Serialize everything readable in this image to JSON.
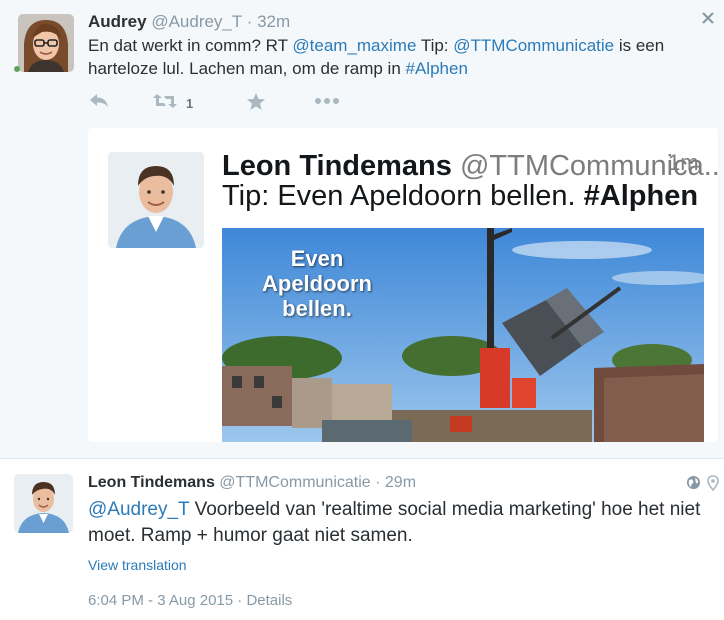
{
  "tweet1": {
    "name": "Audrey",
    "handle": "@Audrey_T",
    "sep": " · ",
    "time": "32m",
    "text_pre": "En dat werkt in comm? RT ",
    "mention1": "@team_maxime",
    "text_mid": " Tip: ",
    "mention2": "@TTMCommunicatie",
    "text_mid2": " is een harteloze lul. Lachen man, om de ramp in ",
    "hashtag": "#Alphen",
    "retweet_count": "1",
    "icons": [
      "reply-icon",
      "retweet-icon",
      "favorite-icon",
      "more-icon",
      "close-icon"
    ]
  },
  "card": {
    "name": "Leon Tindemans",
    "handle": "@TTMCommunica...",
    "time": "1m",
    "text": "Tip: Even Apeldoorn bellen. ",
    "hashtag": "#Alphen",
    "photo_caption": "Even\nApeldoorn\nbellen."
  },
  "tweet2": {
    "name": "Leon Tindemans",
    "handle": "@TTMCommunicatie",
    "sep": " · ",
    "time": "29m",
    "mention": "@Audrey_T",
    "text": " Voorbeeld van 'realtime social media marketing' hoe het niet moet. Ramp + humor gaat niet samen.",
    "view_translation": "View translation",
    "timestamp": "6:04 PM - 3 Aug 2015",
    "details_sep": " · ",
    "details": "Details",
    "icons": [
      "globe-icon",
      "location-icon"
    ]
  },
  "colors": {
    "link": "#2b7bb9",
    "meta": "#8899a6",
    "text": "#292f33",
    "tweet_bg": "#f5f8fa",
    "green_dot": "#5aa65a"
  }
}
